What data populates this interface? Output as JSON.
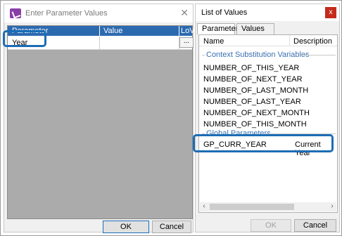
{
  "param_dialog": {
    "title": "Enter Parameter Values",
    "close_symbol": "✕",
    "columns": [
      "Parameter",
      "Value",
      "LoV"
    ],
    "rows": [
      {
        "parameter": "Year",
        "value": "",
        "lov_button": "..."
      }
    ],
    "ok_label": "OK",
    "cancel_label": "Cancel"
  },
  "lov_dialog": {
    "title": "List of Values",
    "close_symbol": "x",
    "tabs": [
      "Parameters",
      "Values"
    ],
    "columns": {
      "name": "Name",
      "description": "Description"
    },
    "group_context": "Context Substitution Variables",
    "context_items": [
      "NUMBER_OF_THIS_YEAR",
      "NUMBER_OF_NEXT_YEAR",
      "NUMBER_OF_LAST_MONTH",
      "NUMBER_OF_LAST_YEAR",
      "NUMBER_OF_NEXT_MONTH",
      "NUMBER_OF_THIS_MONTH"
    ],
    "group_global": "Global Parameters",
    "global_items": [
      {
        "name": "GP_CURR_YEAR",
        "description": "Current Year"
      }
    ],
    "ok_label": "OK",
    "cancel_label": "Cancel"
  },
  "colors": {
    "header_blue": "#2c6ab0",
    "highlight": "#1c6db5",
    "group_text": "#3a6fb0",
    "close_red": "#c42b1c"
  }
}
